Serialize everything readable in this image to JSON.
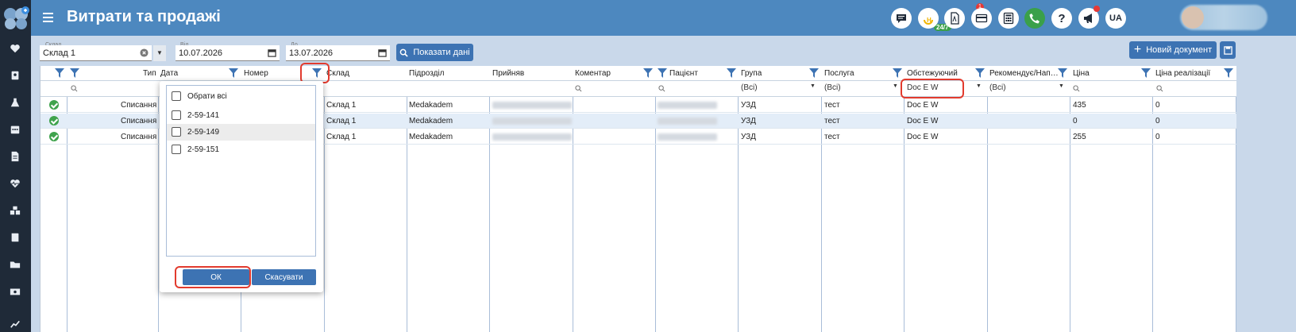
{
  "header": {
    "title": "Витрати та продажі",
    "support_badge": "24/7",
    "notification_count": "1",
    "help_label": "?",
    "language": "UA"
  },
  "toolbar": {
    "warehouse_label": "Склад",
    "warehouse_value": "Склад 1",
    "from_label": "Від",
    "from_value": "10.07.2026",
    "to_label": "До",
    "to_value": "13.07.2026",
    "show_button": "Показати дані",
    "new_doc_button": "Новий документ"
  },
  "grid": {
    "columns": [
      "Тип",
      "Дата",
      "Номер",
      "Склад",
      "Підрозділ",
      "Прийняв",
      "Коментар",
      "Пацієнт",
      "Група",
      "Послуга",
      "Обстежуючий",
      "Рекомендує/Нап…",
      "Ціна",
      "Ціна реалізації"
    ],
    "filters": {
      "group": "(Всі)",
      "service": "(Всі)",
      "examiner": "Doc E W",
      "recommends": "(Всі)"
    },
    "rows": [
      {
        "type": "Списання",
        "warehouse": "Склад 1",
        "division": "Medakadem",
        "group": "УЗД",
        "service": "тест",
        "examiner": "Doc E W",
        "price": "435",
        "sale_price": "0"
      },
      {
        "type": "Списання",
        "warehouse": "Склад 1",
        "division": "Medakadem",
        "group": "УЗД",
        "service": "тест",
        "examiner": "Doc E W",
        "price": "0",
        "sale_price": "0"
      },
      {
        "type": "Списання",
        "warehouse": "Склад 1",
        "division": "Medakadem",
        "group": "УЗД",
        "service": "тест",
        "examiner": "Doc E W",
        "price": "255",
        "sale_price": "0"
      }
    ]
  },
  "filter_popup": {
    "select_all": "Обрати всі",
    "items": [
      "2-59-141",
      "2-59-149",
      "2-59-151"
    ],
    "ok": "ОК",
    "cancel": "Скасувати"
  },
  "colors": {
    "header_bg": "#4d88bf",
    "sidebar_bg": "#1f2a38",
    "accent": "#3d73b3",
    "highlight_ring": "#e23b2e"
  }
}
